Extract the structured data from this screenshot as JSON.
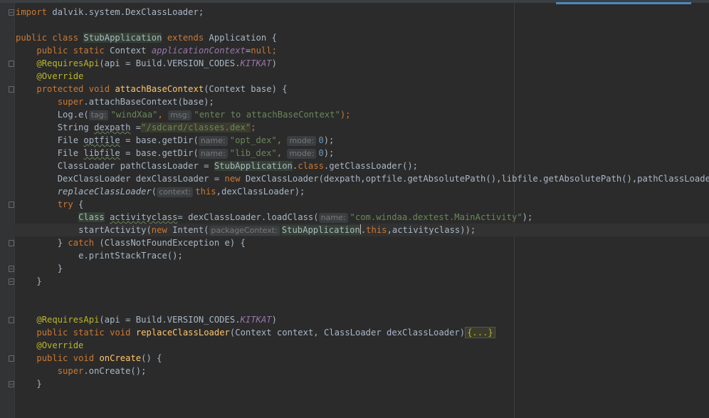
{
  "lines": {
    "l1": {
      "kw": "import",
      "rest": " dalvik.system.DexClassLoader;"
    },
    "l3": {
      "k1": "public",
      "k2": "class",
      "cls": "StubApplication",
      "k3": "extends",
      "rest": " Application {"
    },
    "l4": {
      "k1": "public",
      "k2": "static",
      "type": " Context ",
      "field": "applicationContext",
      "eq": "=",
      "null": "null",
      ";": ";"
    },
    "l5": {
      "ann": "@RequiresApi",
      "rest1": "(api = Build.VERSION_CODES.",
      "const": "KITKAT",
      ")": ")"
    },
    "l6": {
      "ann": "@Override"
    },
    "l7": {
      "k1": "protected",
      "k2": "void",
      "fn": "attachBaseContext",
      "rest": "(Context base) {"
    },
    "l8": {
      "kw": "super",
      "rest": ".attachBaseContext(base);"
    },
    "l9": {
      "pre": "Log.e(",
      "hint1": "tag:",
      "s1": "\"windXaa\"",
      "comma": ", ",
      "hint2": "msg:",
      "s2": "\"enter to attachBaseContext\"",
      "end": ");"
    },
    "l10": {
      "pre": "String ",
      "var": "dexpath",
      "eq": " =",
      "s": "\"/sdcard/classes.dex\"",
      ";": ";"
    },
    "l11": {
      "pre": "File ",
      "var": "optfile",
      "mid": " = base.getDir(",
      "hint1": "name:",
      "s": "\"opt_dex\"",
      "comma": ", ",
      "hint2": "mode:",
      "num": "0",
      "end": ");"
    },
    "l12": {
      "pre": "File ",
      "var": "libfile",
      "mid": " = base.getDir(",
      "hint1": "name:",
      "s": "\"lib_dex\"",
      "comma": ", ",
      "hint2": "mode:",
      "num": "0",
      "end": ");"
    },
    "l13": {
      "pre": "ClassLoader pathClassLoader = ",
      "cls": "StubApplication",
      ".": ".",
      "kw": "class",
      "end": ".getClassLoader();"
    },
    "l14": {
      "pre": "DexClassLoader dexClassLoader = ",
      "kw": "new",
      "end": " DexClassLoader(dexpath,optfile.getAbsolutePath(),libfile.getAbsolutePath(),pathClassLoader);"
    },
    "l15": {
      "fn": "replaceClassLoader",
      "(": "(",
      "hint": "context:",
      "kw": "this",
      "end": ",dexClassLoader);"
    },
    "l16": {
      "kw": "try",
      "end": " {"
    },
    "l17": {
      "cls": "Class",
      "sp": " ",
      "var": "activityclass",
      "mid": "= dexClassLoader.loadClass(",
      "hint": "name:",
      "s": "\"com.windaa.dextest.MainActivity\"",
      "end": ");"
    },
    "l18": {
      "pre": "startActivity(",
      "kw": "new",
      "mid": " Intent(",
      "hint": "packageContext:",
      "cls": "StubApplication",
      "dot": ".",
      "kw2": "this",
      "end": ",activityclass));"
    },
    "l19": {
      "pre": "} ",
      "kw": "catch",
      "end": " (ClassNotFoundException e) {"
    },
    "l20": {
      "text": "e.printStackTrace();"
    },
    "l21": {
      "text": "}"
    },
    "l22": {
      "text": "}"
    },
    "l25": {
      "ann": "@RequiresApi",
      "rest1": "(api = Build.VERSION_CODES.",
      "const": "KITKAT",
      ")": ")"
    },
    "l26": {
      "k1": "public",
      "k2": "static",
      "k3": "void",
      "fn": "replaceClassLoader",
      "rest": "(Context context, ClassLoader dexClassLoader)",
      "folded": "{...}"
    },
    "l27": {
      "ann": "@Override"
    },
    "l28": {
      "k1": "public",
      "k2": "void",
      "fn": "onCreate",
      "rest": "() {"
    },
    "l29": {
      "kw": "super",
      "rest": ".onCreate();"
    },
    "l30": {
      "text": "}"
    }
  }
}
